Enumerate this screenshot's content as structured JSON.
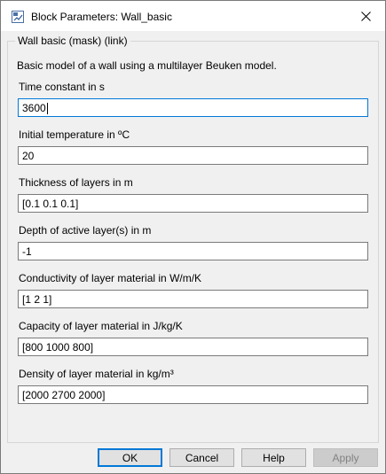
{
  "window": {
    "title": "Block Parameters: Wall_basic"
  },
  "group": {
    "legend": "Wall basic (mask) (link)",
    "description": "Basic model of a wall using a multilayer Beuken model."
  },
  "fields": [
    {
      "label": "Time constant in s",
      "value": "3600"
    },
    {
      "label": "Initial temperature in ºC",
      "value": "20"
    },
    {
      "label": "Thickness of layers in m",
      "value": "[0.1 0.1 0.1]"
    },
    {
      "label": "Depth of active layer(s) in m",
      "value": "-1"
    },
    {
      "label": "Conductivity of layer material in W/m/K",
      "value": "[1 2 1]"
    },
    {
      "label": "Capacity of layer material in J/kg/K",
      "value": "[800 1000 800]"
    },
    {
      "label": "Density of layer material in kg/m³",
      "value": "[2000 2700 2000]"
    }
  ],
  "buttons": {
    "ok": "OK",
    "cancel": "Cancel",
    "help": "Help",
    "apply": "Apply"
  },
  "colors": {
    "focus_border": "#0078d7",
    "dialog_bg": "#f0f0f0"
  },
  "icons": {
    "app": "simulink-block-icon",
    "close": "close-icon"
  }
}
